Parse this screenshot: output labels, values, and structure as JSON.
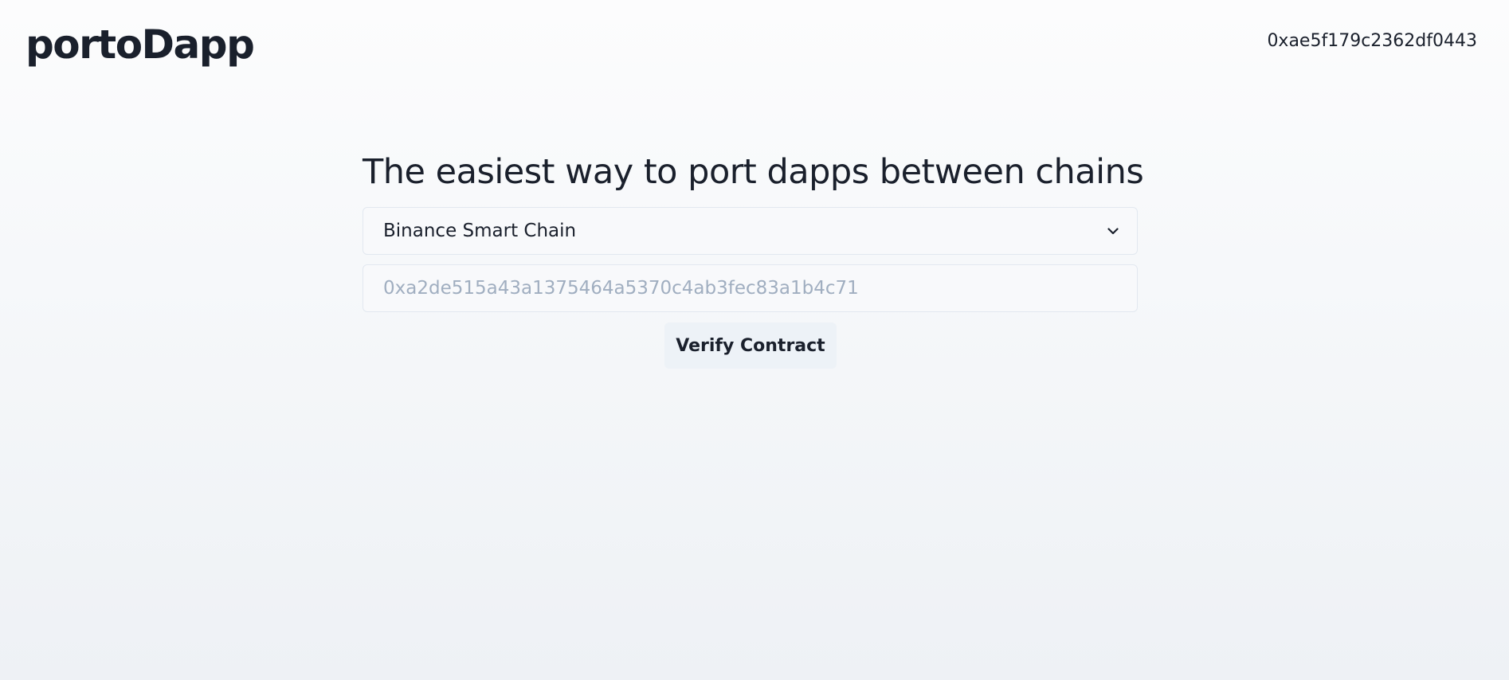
{
  "header": {
    "logo": "portoDapp",
    "wallet_address": "0xae5f179c2362df0443"
  },
  "main": {
    "title": "The easiest way to port dapps between chains",
    "chain_select": {
      "selected": "Binance Smart Chain",
      "icon": "chevron-down-icon"
    },
    "contract_input": {
      "placeholder": "0xa2de515a43a1375464a5370c4ab3fec83a1b4c71",
      "value": ""
    },
    "verify_button_label": "Verify Contract"
  },
  "colors": {
    "text": "#1a202c",
    "placeholder": "#a0aec0",
    "border": "#e2e8f0",
    "button_bg": "#edf2f7"
  }
}
